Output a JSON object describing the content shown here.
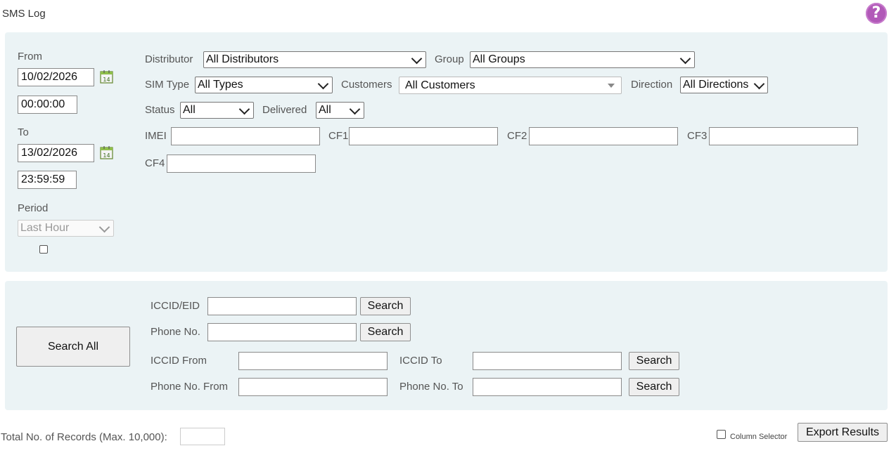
{
  "page": {
    "title": "SMS Log"
  },
  "help": {
    "icon": "question-mark-icon",
    "glyph": "?"
  },
  "dates": {
    "from_label": "From",
    "from_date": "10/02/2026",
    "from_time": "00:00:00",
    "to_label": "To",
    "to_date": "13/02/2026",
    "to_time": "23:59:59",
    "period_label": "Period",
    "period_value": "Last Hour"
  },
  "filters": {
    "distributor_label": "Distributor",
    "distributor_value": "All Distributors",
    "group_label": "Group",
    "group_value": "All Groups",
    "simtype_label": "SIM Type",
    "simtype_value": "All Types",
    "customers_label": "Customers",
    "customers_value": "All Customers",
    "direction_label": "Direction",
    "direction_value": "All Directions",
    "status_label": "Status",
    "status_value": "All",
    "delivered_label": "Delivered",
    "delivered_value": "All",
    "imei_label": "IMEI",
    "cf1_label": "CF1",
    "cf2_label": "CF2",
    "cf3_label": "CF3",
    "cf4_label": "CF4"
  },
  "search": {
    "search_all_label": "Search All",
    "iccid_label": "ICCID/EID",
    "phone_label": "Phone No.",
    "iccid_from_label": "ICCID From",
    "iccid_to_label": "ICCID To",
    "phone_from_label": "Phone No. From",
    "phone_to_label": "Phone No. To",
    "search_button_label": "Search"
  },
  "footer": {
    "total_label": "Total No. of Records (Max. 10,000):",
    "column_selector_label": "Column Selector",
    "export_label": "Export Results"
  }
}
